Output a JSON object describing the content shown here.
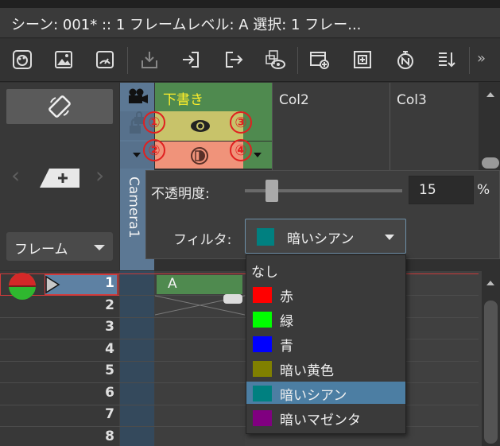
{
  "window": {
    "title": "シーン: 001*   ::   1 フレームレベル: A   選択: 1 フレー..."
  },
  "toolbar": {
    "icons": [
      "palette-icon",
      "image-icon",
      "gauge-icon",
      "import-icon",
      "enter-icon",
      "exit-icon",
      "preview-icon",
      "new-level-icon",
      "duplicate-icon",
      "stopwatch-icon",
      "sort-icon"
    ],
    "overflow": "»"
  },
  "leftpanel": {
    "frame_select": "フレーム"
  },
  "camera": {
    "label": "Camera1"
  },
  "draft_column": {
    "title": "下書き",
    "markers": [
      "①",
      "②",
      "③",
      "④"
    ]
  },
  "columns": [
    "Col2",
    "Col3"
  ],
  "popup": {
    "opacity_label": "不透明度:",
    "opacity_value": "15",
    "opacity_unit": "%",
    "filter_label": "フィルタ:",
    "filter_value": "暗いシアン",
    "filter_color": "#008080"
  },
  "filter_options": [
    {
      "label": "なし",
      "color": ""
    },
    {
      "label": "赤",
      "color": "#ff0000"
    },
    {
      "label": "緑",
      "color": "#00ff00"
    },
    {
      "label": "青",
      "color": "#0000ff"
    },
    {
      "label": "暗い黄色",
      "color": "#808000"
    },
    {
      "label": "暗いシアン",
      "color": "#008080",
      "selected": true
    },
    {
      "label": "暗いマゼンタ",
      "color": "#800080"
    }
  ],
  "xsheet": {
    "frames": [
      "1",
      "2",
      "3",
      "4",
      "5",
      "6",
      "7",
      "8"
    ],
    "cell_text": "A"
  }
}
